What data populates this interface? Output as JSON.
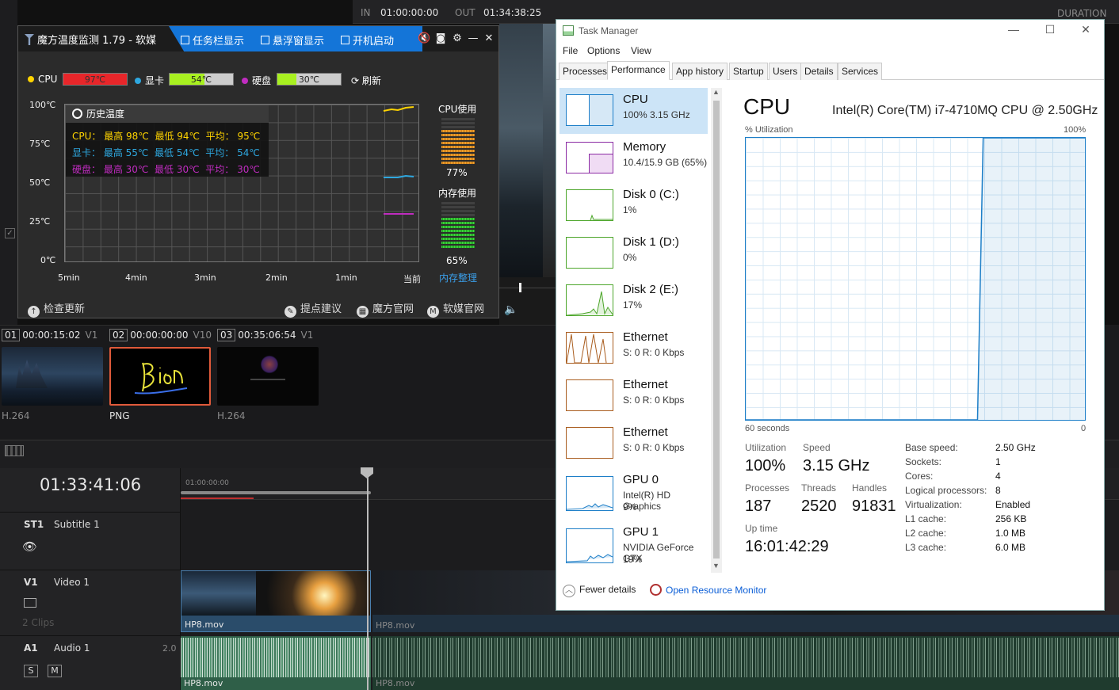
{
  "editor": {
    "in_label": "IN",
    "in_value": "01:00:00:00",
    "out_label": "OUT",
    "out_value": "01:34:38:25",
    "duration_label": "DURATION",
    "clips": [
      {
        "num": "01",
        "tc": "00:00:15:02",
        "track": "V1",
        "codec": "H.264"
      },
      {
        "num": "02",
        "tc": "00:00:00:00",
        "track": "V10",
        "codec": "PNG"
      },
      {
        "num": "03",
        "tc": "00:35:06:54",
        "track": "V1",
        "codec": "H.264"
      }
    ],
    "timecode": "01:33:41:06",
    "ruler_start": "01:00:00:00",
    "tracks": {
      "st1": {
        "id": "ST1",
        "name": "Subtitle 1"
      },
      "v1": {
        "id": "V1",
        "name": "Video 1",
        "clips_info": "2 Clips"
      },
      "a1": {
        "id": "A1",
        "name": "Audio 1",
        "level": "2.0",
        "solo": "S",
        "mute": "M"
      }
    },
    "clip_name": "HP8.mov"
  },
  "mofang": {
    "title": "魔方温度监测 1.79 - 软媒",
    "opt_taskbar": "任务栏显示",
    "opt_float": "悬浮窗显示",
    "opt_startup": "开机启动",
    "cpu_label": "CPU",
    "cpu_temp": "97℃",
    "gpu_label": "显卡",
    "gpu_temp": "54℃",
    "disk_label": "硬盘",
    "disk_temp": "30℃",
    "refresh": "刷新",
    "y_labels": [
      "100℃",
      "75℃",
      "50℃",
      "25℃",
      "0℃"
    ],
    "x_labels": [
      "5min",
      "4min",
      "3min",
      "2min",
      "1min",
      "当前"
    ],
    "history_title": "历史温度",
    "history": {
      "cpu": {
        "name": "CPU：",
        "max": "最高 98℃",
        "min": "最低 94℃",
        "avg": "平均： 95℃"
      },
      "gpu": {
        "name": "显卡：",
        "max": "最高 55℃",
        "min": "最低 54℃",
        "avg": "平均： 54℃"
      },
      "disk": {
        "name": "硬盘：",
        "max": "最高 30℃",
        "min": "最低 30℃",
        "avg": "平均： 30℃"
      }
    },
    "cpu_usage_label": "CPU使用",
    "cpu_usage": "77%",
    "cpu_usage_frac": 0.77,
    "mem_usage_label": "内存使用",
    "mem_usage": "65%",
    "mem_usage_frac": 0.65,
    "mem_clean": "内存整理",
    "check_update": "检查更新",
    "suggest": "提点建议",
    "site": "魔方官网",
    "ruanmei": "软媒官网",
    "colors": {
      "cpu": "#ffd400",
      "gpu": "#2ea8e0",
      "disk": "#c02cc0"
    }
  },
  "taskmgr": {
    "title": "Task Manager",
    "menu": [
      "File",
      "Options",
      "View"
    ],
    "tabs": [
      "Processes",
      "Performance",
      "App history",
      "Startup",
      "Users",
      "Details",
      "Services"
    ],
    "active_tab": "Performance",
    "sidebar": [
      {
        "name": "CPU",
        "sub": "100%  3.15 GHz",
        "color": "#1e7fc8"
      },
      {
        "name": "Memory",
        "sub": "10.4/15.9 GB (65%)",
        "color": "#8b2ba4"
      },
      {
        "name": "Disk 0 (C:)",
        "sub": "1%",
        "color": "#4da62b"
      },
      {
        "name": "Disk 1 (D:)",
        "sub": "0%",
        "color": "#4da62b"
      },
      {
        "name": "Disk 2 (E:)",
        "sub": "17%",
        "color": "#4da62b"
      },
      {
        "name": "Ethernet",
        "sub_s": "S:",
        "sub_sv": "0",
        "sub_r": "R:",
        "sub_rv": "0 Kbps",
        "color": "#a95d1f"
      },
      {
        "name": "Ethernet",
        "sub_s": "S:",
        "sub_sv": "0",
        "sub_r": "R:",
        "sub_rv": "0 Kbps",
        "color": "#a95d1f"
      },
      {
        "name": "Ethernet",
        "sub_s": "S:",
        "sub_sv": "0",
        "sub_r": "R:",
        "sub_rv": "0 Kbps",
        "color": "#a95d1f"
      },
      {
        "name": "GPU 0",
        "sub": "Intel(R) HD Graphics",
        "sub2": "9%",
        "color": "#1e7fc8"
      },
      {
        "name": "GPU 1",
        "sub": "NVIDIA GeForce GTX",
        "sub2": "19%",
        "color": "#1e7fc8"
      }
    ],
    "cpu_title": "CPU",
    "cpu_model": "Intel(R) Core(TM) i7-4710MQ CPU @ 2.50GHz",
    "util_label": "% Utilization",
    "util_max": "100%",
    "time_left": "60 seconds",
    "time_right": "0",
    "stats": {
      "utilization_label": "Utilization",
      "utilization": "100%",
      "speed_label": "Speed",
      "speed": "3.15 GHz",
      "processes_label": "Processes",
      "processes": "187",
      "threads_label": "Threads",
      "threads": "2520",
      "handles_label": "Handles",
      "handles": "91831",
      "uptime_label": "Up time",
      "uptime": "16:01:42:29"
    },
    "specs": [
      {
        "k": "Base speed:",
        "v": "2.50 GHz"
      },
      {
        "k": "Sockets:",
        "v": "1"
      },
      {
        "k": "Cores:",
        "v": "4"
      },
      {
        "k": "Logical processors:",
        "v": "8"
      },
      {
        "k": "Virtualization:",
        "v": "Enabled"
      },
      {
        "k": "L1 cache:",
        "v": "256 KB"
      },
      {
        "k": "L2 cache:",
        "v": "1.0 MB"
      },
      {
        "k": "L3 cache:",
        "v": "6.0 MB"
      }
    ],
    "fewer_details": "Fewer details",
    "open_monitor": "Open Resource Monitor",
    "cpu_util_series": [
      0,
      0,
      0,
      0,
      0,
      0,
      0,
      0,
      0,
      0,
      0,
      0,
      0,
      0,
      0,
      0,
      0,
      0,
      0,
      0,
      0,
      0,
      0,
      0,
      0,
      0,
      0,
      0,
      0,
      0,
      0,
      0,
      0,
      0,
      0,
      0,
      0,
      0,
      0,
      0,
      0,
      0,
      100,
      100,
      100,
      100,
      100,
      100,
      100,
      100,
      100,
      100,
      100,
      100,
      100,
      100,
      100,
      100,
      100,
      100,
      100
    ]
  }
}
